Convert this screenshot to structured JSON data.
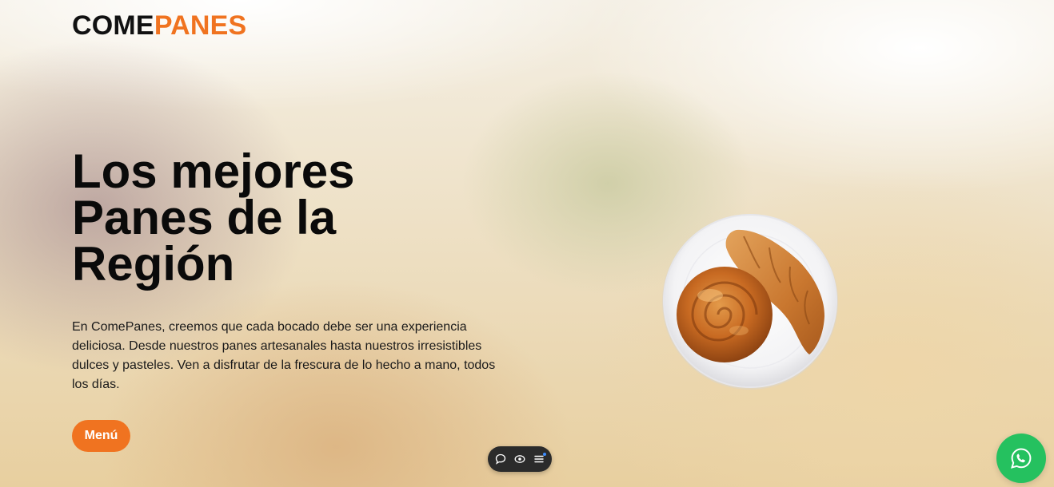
{
  "brand": {
    "name_part1": "COME",
    "name_part2": "PANES",
    "accent_color": "#f07320"
  },
  "hero": {
    "title": "Los mejores Panes de la Región",
    "description": "En ComePanes, creemos que cada bocado debe ser una experiencia deliciosa. Desde nuestros panes artesanales hasta nuestros irresistibles dulces y pasteles. Ven a disfrutar de la frescura de lo hecho a mano, todos los días.",
    "cta_label": "Menú",
    "image": "plate-with-croissant-and-sweet-roll"
  },
  "floating_toolbar": {
    "icons": [
      "comment-icon",
      "eye-icon",
      "menu-list-icon"
    ]
  },
  "whatsapp": {
    "icon": "whatsapp-icon",
    "color": "#25c15f"
  }
}
